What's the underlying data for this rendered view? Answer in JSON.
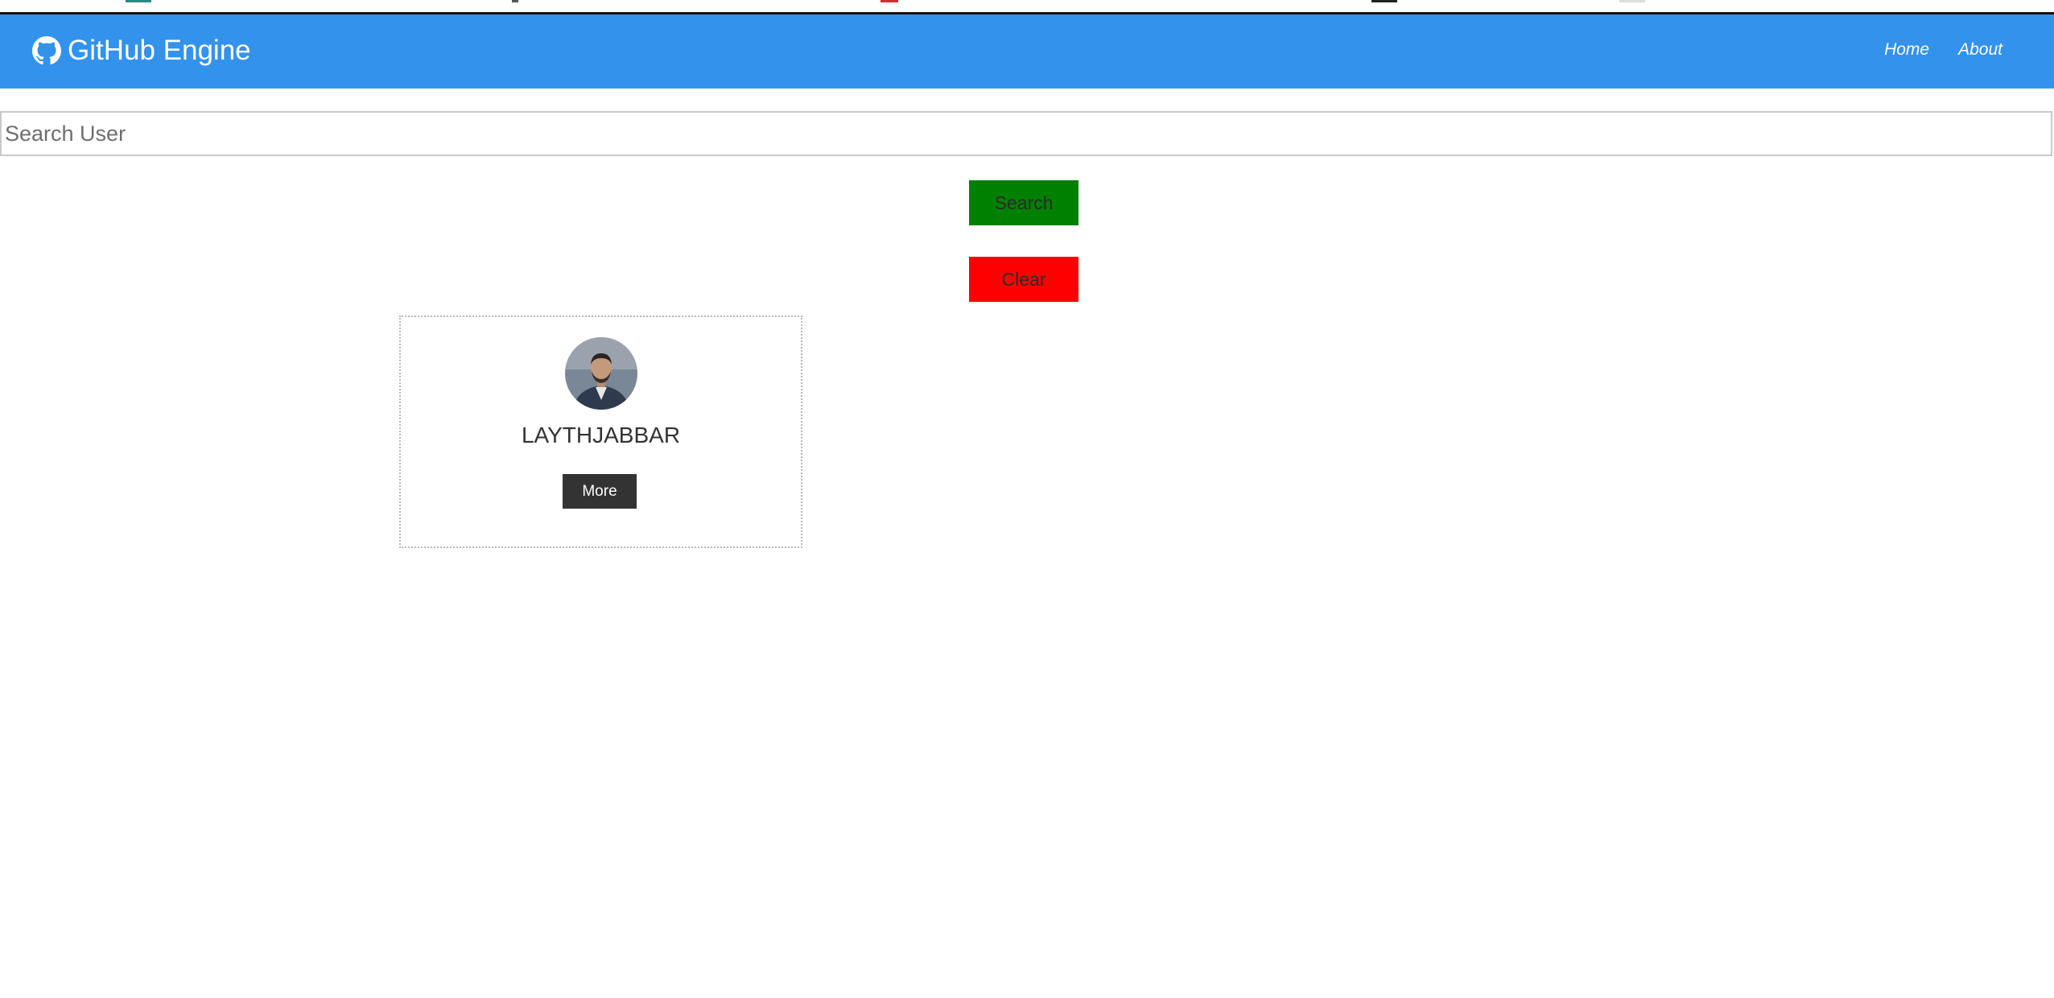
{
  "navbar": {
    "title": "GitHub Engine",
    "links": [
      {
        "label": "Home"
      },
      {
        "label": "About"
      }
    ],
    "background": "#3392eb"
  },
  "search": {
    "placeholder": "Search User",
    "value": ""
  },
  "buttons": {
    "search_label": "Search",
    "search_color": "#008000",
    "clear_label": "Clear",
    "clear_color": "#ff0000"
  },
  "users": [
    {
      "username": "LAYTHJABBAR",
      "more_label": "More"
    }
  ],
  "icons": {
    "brand": "github-icon",
    "avatar": "user-avatar-photo"
  }
}
